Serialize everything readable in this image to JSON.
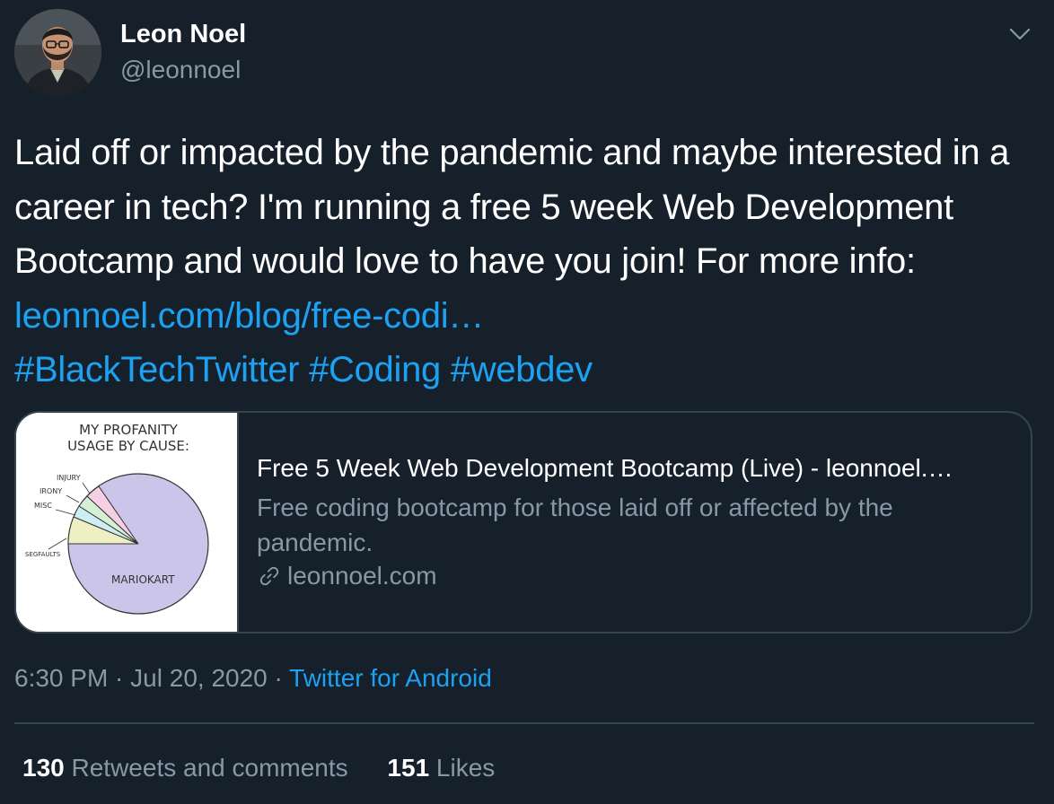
{
  "author": {
    "name": "Leon Noel",
    "handle": "@leonnoel"
  },
  "header": {
    "more_icon": "chevron-down-icon"
  },
  "tweet": {
    "text_plain": "Laid off or impacted by the pandemic and maybe interested in a career in tech? I'm running a free 5 week Web Development Bootcamp and would love to have you join! For more info: ",
    "link_text": "leonnoel.com/blog/free-codi…",
    "hashtags": [
      "#BlackTechTwitter",
      "#Coding",
      "#webdev"
    ]
  },
  "card": {
    "image": {
      "title_line1": "MY PROFANITY",
      "title_line2": "USAGE BY CAUSE:",
      "labels": [
        "INJURY",
        "IRONY",
        "MISC",
        "SEGFAULTS",
        "MARIOKART"
      ]
    },
    "title": "Free 5 Week Web Development Bootcamp (Live) - leonnoel.…",
    "description": "Free coding bootcamp for those laid off or affected by the pandemic.",
    "domain": "leonnoel.com",
    "domain_icon": "link-icon"
  },
  "meta": {
    "time": "6:30 PM",
    "separator": " · ",
    "date": "Jul 20, 2020",
    "source": "Twitter for Android"
  },
  "stats": {
    "retweets_count": "130",
    "retweets_label": "Retweets and comments",
    "likes_count": "151",
    "likes_label": "Likes"
  },
  "colors": {
    "background": "#15202b",
    "accent": "#1da1f2",
    "secondary_text": "#8899a6",
    "border": "#38444d"
  }
}
